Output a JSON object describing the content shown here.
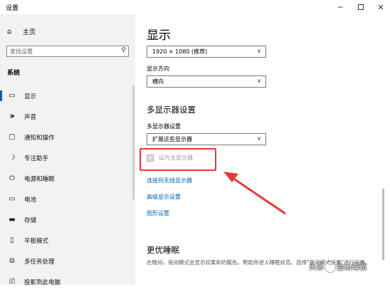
{
  "app": {
    "title": "设置"
  },
  "sidebar": {
    "home_label": "主页",
    "search_placeholder": "查找设置",
    "section_label": "系统",
    "items": [
      {
        "icon": "monitor-icon",
        "label": "显示"
      },
      {
        "icon": "speaker-icon",
        "label": "声音"
      },
      {
        "icon": "notification-icon",
        "label": "通知和操作"
      },
      {
        "icon": "moon-icon",
        "label": "专注助手"
      },
      {
        "icon": "power-icon",
        "label": "电源和睡眠"
      },
      {
        "icon": "battery-icon",
        "label": "电池"
      },
      {
        "icon": "storage-icon",
        "label": "存储"
      },
      {
        "icon": "tablet-icon",
        "label": "平板模式"
      },
      {
        "icon": "multitasking-icon",
        "label": "多任务处理"
      },
      {
        "icon": "project-icon",
        "label": "投影到此电脑"
      }
    ]
  },
  "main": {
    "title": "显示",
    "resolution_value": "1920 × 1080 (推荐)",
    "orientation_label": "显示方向",
    "orientation_value": "横向",
    "multi_display_heading": "多显示器设置",
    "multi_display_label": "多显示器设置",
    "multi_display_value": "扩展这些显示器",
    "primary_checkbox_label": "设为主显示器",
    "links": [
      "连接到无线显示器",
      "高级显示设置",
      "图形设置"
    ],
    "sleep_heading": "更优睡眠",
    "sleep_desc": "在晚间，夜间模式会显示较柔和的暖色，帮助你进入睡眠状态。选择\"夜间模式设置\"进行设置。"
  },
  "watermark": {
    "prefix": "头条",
    "suffix": "金山毒霸"
  },
  "colors": {
    "accent": "#0063b1",
    "annotation": "#e53935",
    "sidebar_bg": "#f2f2f2"
  }
}
